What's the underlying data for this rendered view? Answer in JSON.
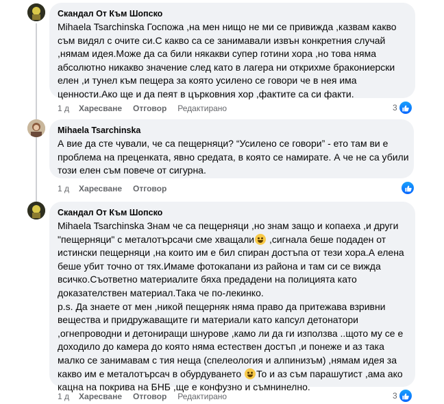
{
  "comments": [
    {
      "author": "Скандал От Към Шопско",
      "lines": [
        "Mihaela Tsarchinska Госпожа ,на мен нищо не ми се привижда ,казвам какво",
        "съм видял с очите си.С какво са се занимавали извън конкретния случай",
        ",нямам идея.Може да са били някакви супер готини хора ,но това няма",
        "абсолютно никакво значение след като в лагера ни открихме бракониерски",
        "елен ,и тунел към пещера за която усилено се говори че в нея има",
        "ценности.Ако ще и да пеят в църковния хор ,фактите са си факти."
      ],
      "time": "1 д",
      "like_label": "Харесване",
      "reply_label": "Отговор",
      "edited_label": "Редактирано",
      "reactions": "3"
    },
    {
      "author": "Mihaela Tsarchinska",
      "lines": [
        "А вие да сте чували, че са пещерняци? “Усилено се говори” - ето там ви е",
        "проблема на преценката, явно средата, в която се намирате. А че не са убили",
        "този елен съм повече от сигурна."
      ],
      "time": "1 д",
      "like_label": "Харесване",
      "reply_label": "Отговор",
      "reactions": ""
    },
    {
      "author": "Скандал От Към Шопско",
      "line1": "Mihaela Tsarchinska Знам че са пещерняци ,но знам защо и копаеха ,и други",
      "line2a": "\"пещерняци\" с металотърсачи сме хващали",
      "line2b": " ,сигнала беше подаден от",
      "lines_mid": [
        "истински пещерняци ,на които им е бил спиран достъпа от тези хора.А елена",
        "беше убит точно от тях.Имаме фотокапани из района и там си се вижда",
        "всичко.Съответно материалите бяха предадени на полицията като",
        "доказателствен материал.Така че по-лекинко.",
        "p.s. Да знаете от мен ,никой пещерняк няма право да притежава взривни",
        "вещества и придружаващите ги материали като капсул детонатори",
        ",огнепроводни и детониращи шнурове ,камо ли да ги използва ..щото му се е",
        "доходило до камера до която няма естествен достъп ,и понеже и аз така",
        "малко се занимавам с тия неща (спелеология и алпинизъм) ,нямам идея за"
      ],
      "line_last_a": "какво им е металотърсач в обурдуването",
      "line_last_b": "То и аз съм парашутист ,ама ако",
      "line_final": "кацна на покрива на БНБ ,ще е конфузно и съмнинелно.",
      "time": "1 д",
      "like_label": "Харесване",
      "reply_label": "Отговор",
      "edited_label": "Редактирано",
      "reactions": "3"
    }
  ],
  "icons": {
    "like": "thumbs-up-icon",
    "emoji": "grinning-face-emoji"
  },
  "colors": {
    "bubble": "#f0f2f5",
    "like": "#0866ff",
    "meta": "#65676b"
  }
}
